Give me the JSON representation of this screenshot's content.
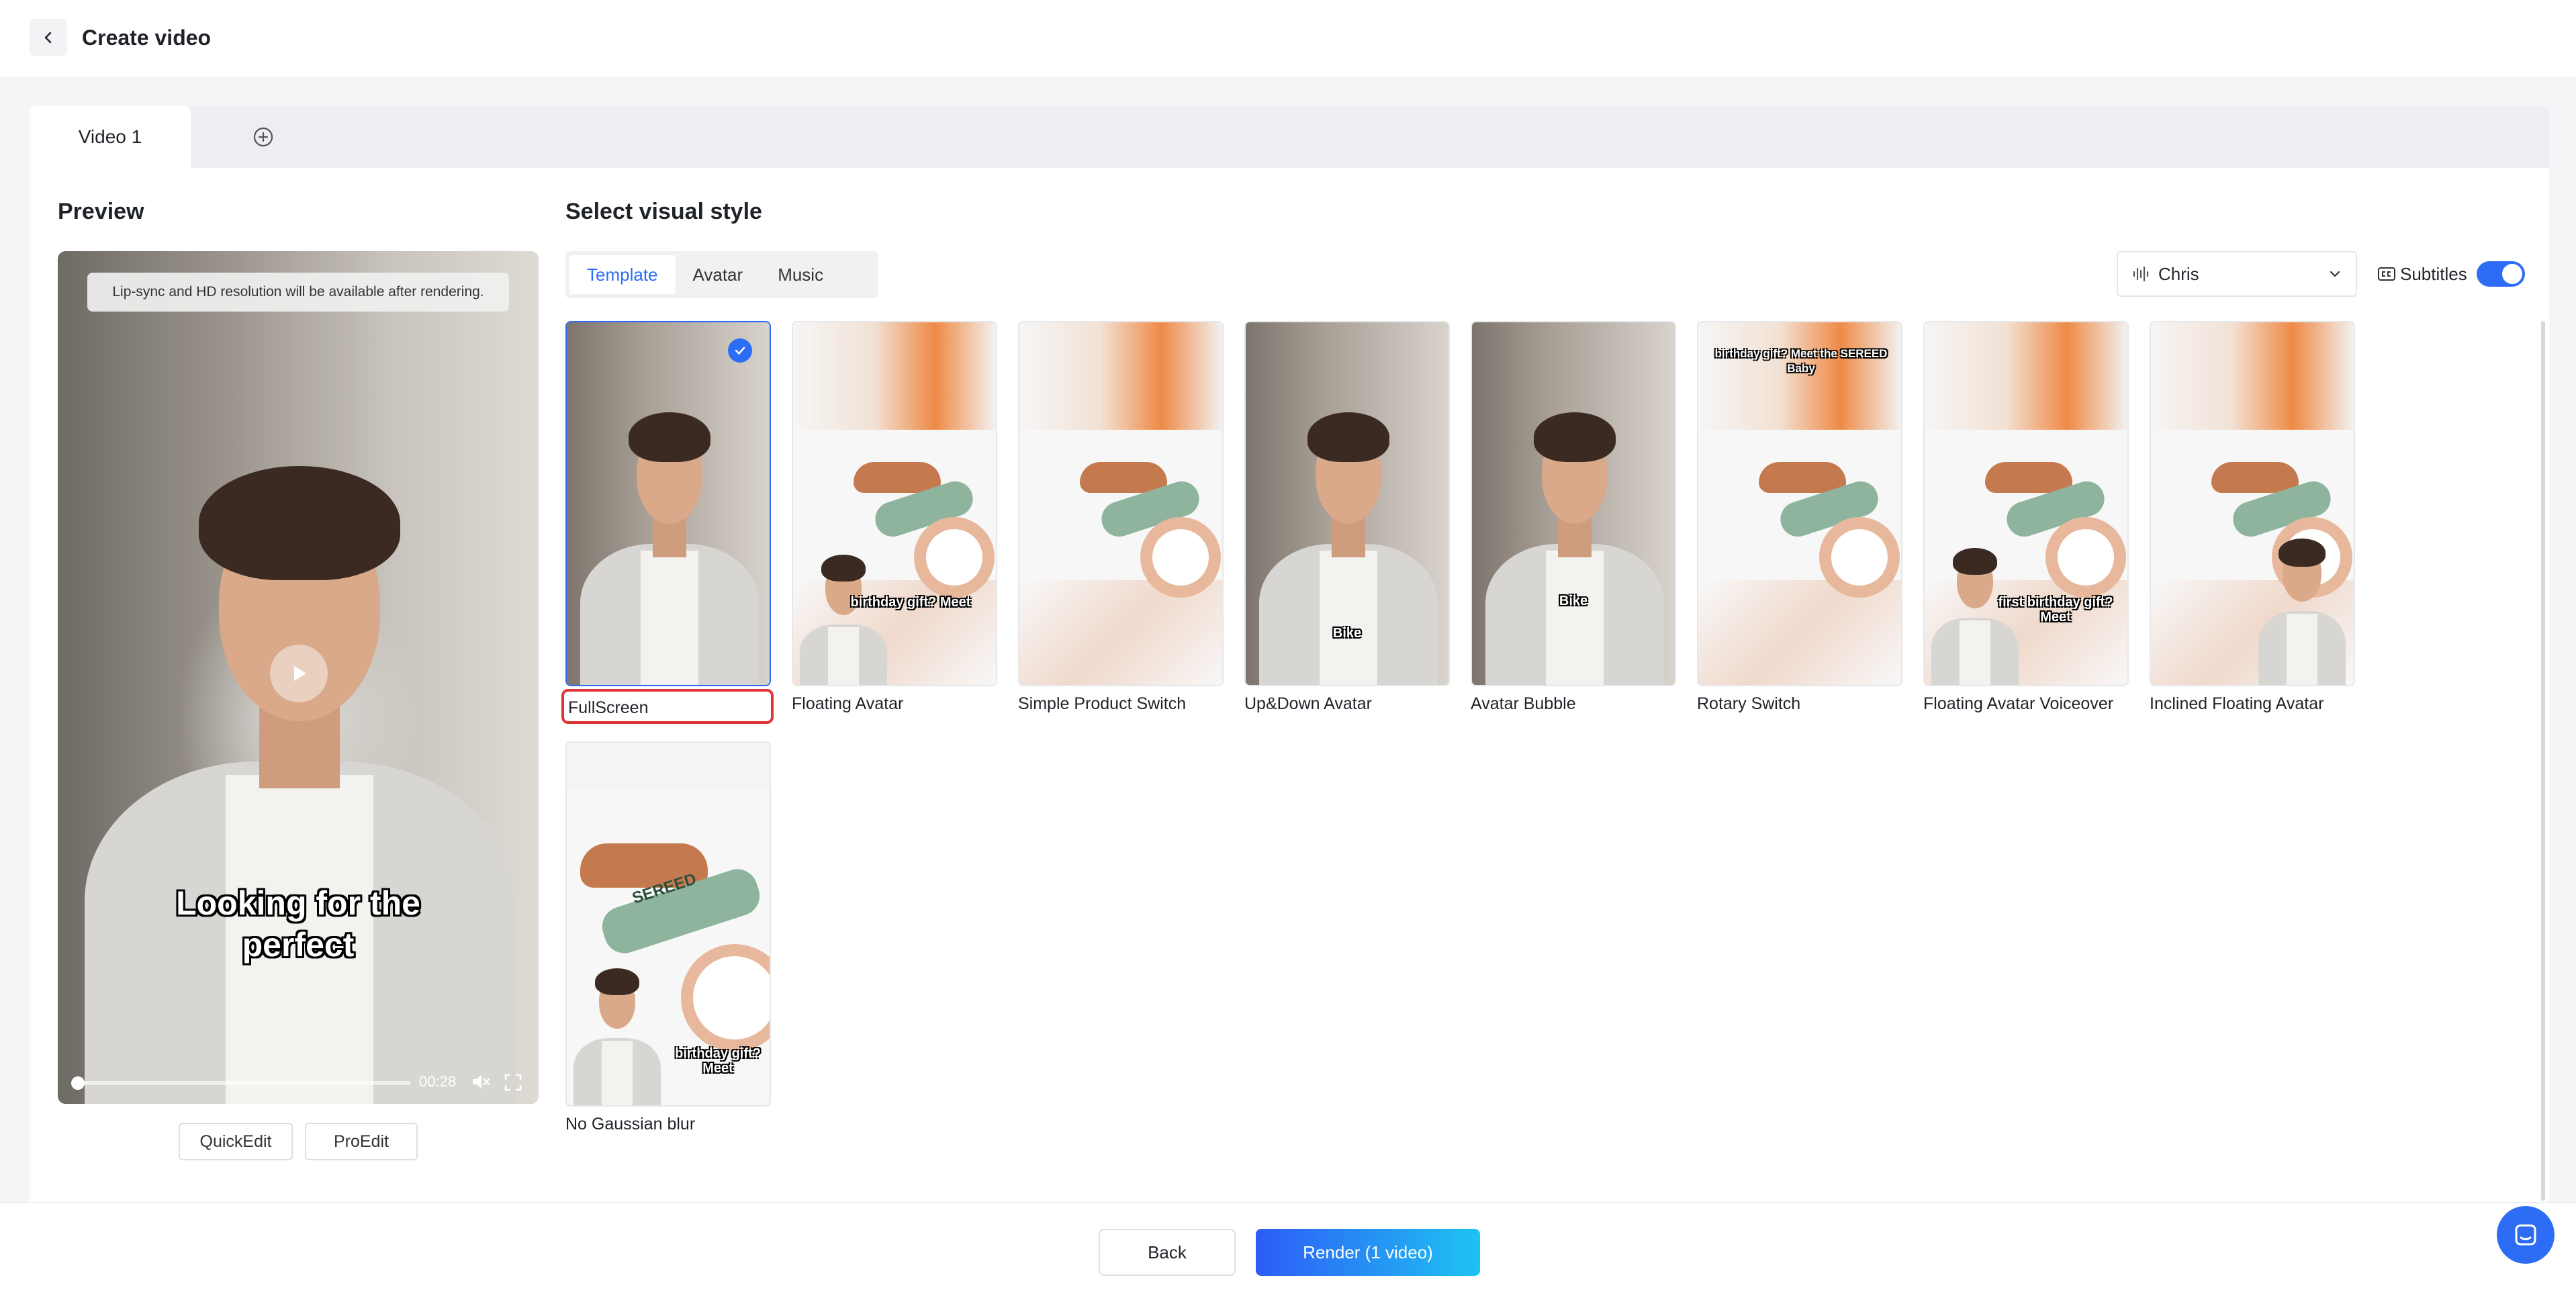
{
  "header": {
    "title": "Create video"
  },
  "tabs": {
    "video_tab": "Video 1"
  },
  "preview": {
    "title": "Preview",
    "notice": "Lip-sync and HD resolution will be available after rendering.",
    "caption": "Looking for the perfect",
    "time": "00:28",
    "quickedit_label": "QuickEdit",
    "proedit_label": "ProEdit"
  },
  "style": {
    "title": "Select visual style",
    "tabs": [
      {
        "label": "Template",
        "active": true
      },
      {
        "label": "Avatar",
        "active": false
      },
      {
        "label": "Music",
        "active": false
      }
    ],
    "voice": "Chris",
    "subtitles_label": "Subtitles",
    "subtitles_on": true,
    "templates": [
      {
        "label": "FullScreen",
        "selected": true
      },
      {
        "label": "Floating Avatar",
        "caption": "birthday gift? Meet"
      },
      {
        "label": "Simple Product Switch"
      },
      {
        "label": "Up&Down Avatar",
        "caption": "Bike"
      },
      {
        "label": "Avatar Bubble",
        "caption": "Bike"
      },
      {
        "label": "Rotary Switch",
        "caption": "birthday gift? Meet the SEREED Baby"
      },
      {
        "label": "Floating Avatar Voiceover",
        "caption": "first birthday gift? Meet"
      },
      {
        "label": "Inclined Floating Avatar"
      },
      {
        "label": "No Gaussian blur",
        "caption": "birthday gift? Meet"
      }
    ],
    "brand_text": "SEREED"
  },
  "footer": {
    "back_label": "Back",
    "render_label": "Render (1 video)"
  },
  "colors": {
    "accent": "#2d6df6",
    "selected_outline": "#e03535"
  }
}
